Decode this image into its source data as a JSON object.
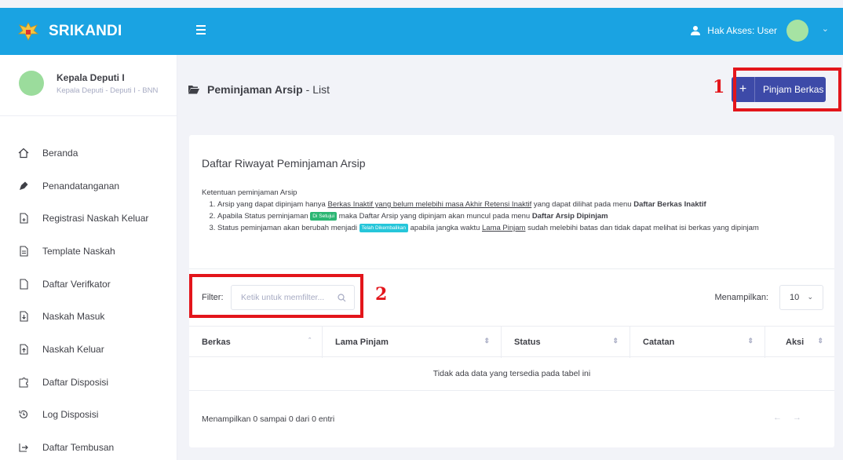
{
  "brand": {
    "name": "SRIKANDI"
  },
  "topbar": {
    "access_label": "Hak Akses: User"
  },
  "profile": {
    "name": "Kepala Deputi I",
    "role": "Kepala Deputi - Deputi I - BNN"
  },
  "sidebar": {
    "items": [
      {
        "label": "Beranda",
        "icon": "home-icon"
      },
      {
        "label": "Penandatanganan",
        "icon": "pen-icon"
      },
      {
        "label": "Registrasi Naskah Keluar",
        "icon": "file-add-icon"
      },
      {
        "label": "Template Naskah",
        "icon": "document-icon"
      },
      {
        "label": "Daftar Verifkator",
        "icon": "file-check-icon"
      },
      {
        "label": "Naskah Masuk",
        "icon": "download-file-icon"
      },
      {
        "label": "Naskah Keluar",
        "icon": "upload-file-icon"
      },
      {
        "label": "Daftar Disposisi",
        "icon": "puzzle-icon"
      },
      {
        "label": "Log Disposisi",
        "icon": "history-icon"
      },
      {
        "label": "Daftar Tembusan",
        "icon": "forward-icon"
      }
    ]
  },
  "page": {
    "title": "Peminjaman Arsip",
    "subtitle": "- List",
    "add_button_label": "Pinjam Berkas"
  },
  "card": {
    "title": "Daftar Riwayat Peminjaman Arsip",
    "rules_heading": "Ketentuan peminjaman Arsip",
    "rule1_a": "Arsip yang dapat dipinjam hanya ",
    "rule1_link": "Berkas Inaktif yang belum melebihi masa Akhir Retensi Inaktif",
    "rule1_b": " yang dapat dilihat pada menu ",
    "rule1_menu": "Daftar Berkas Inaktif",
    "rule2_a": "Apabila Status peminjaman ",
    "rule2_badge": "Di Setujui",
    "rule2_b": " maka Daftar Arsip yang dipinjam akan muncul pada menu ",
    "rule2_menu": "Daftar Arsip Dipinjam",
    "rule3_a": "Status peminjaman akan berubah menjadi ",
    "rule3_badge": "Telah Dikembalikan",
    "rule3_b": " apabila jangka waktu ",
    "rule3_link": "Lama Pinjam",
    "rule3_c": " sudah melebihi batas dan tidak dapat melihat isi berkas yang dipinjam"
  },
  "table": {
    "filter_label": "Filter:",
    "filter_placeholder": "Ketik untuk memfilter...",
    "show_label": "Menampilkan:",
    "page_size": "10",
    "columns": [
      "Berkas",
      "Lama Pinjam",
      "Status",
      "Catatan",
      "Aksi"
    ],
    "empty_text": "Tidak ada data yang tersedia pada tabel ini",
    "info_text": "Menampilkan 0 sampai 0 dari 0 entri",
    "prev": "←",
    "next": "→"
  },
  "annotations": {
    "marker1": "1",
    "marker2": "2"
  },
  "colors": {
    "topbar": "#1aa3e2",
    "primary_button": "#3d4aa8",
    "marker": "#e3151b",
    "approved_badge": "#2bb673",
    "returned_badge": "#26c6da"
  }
}
